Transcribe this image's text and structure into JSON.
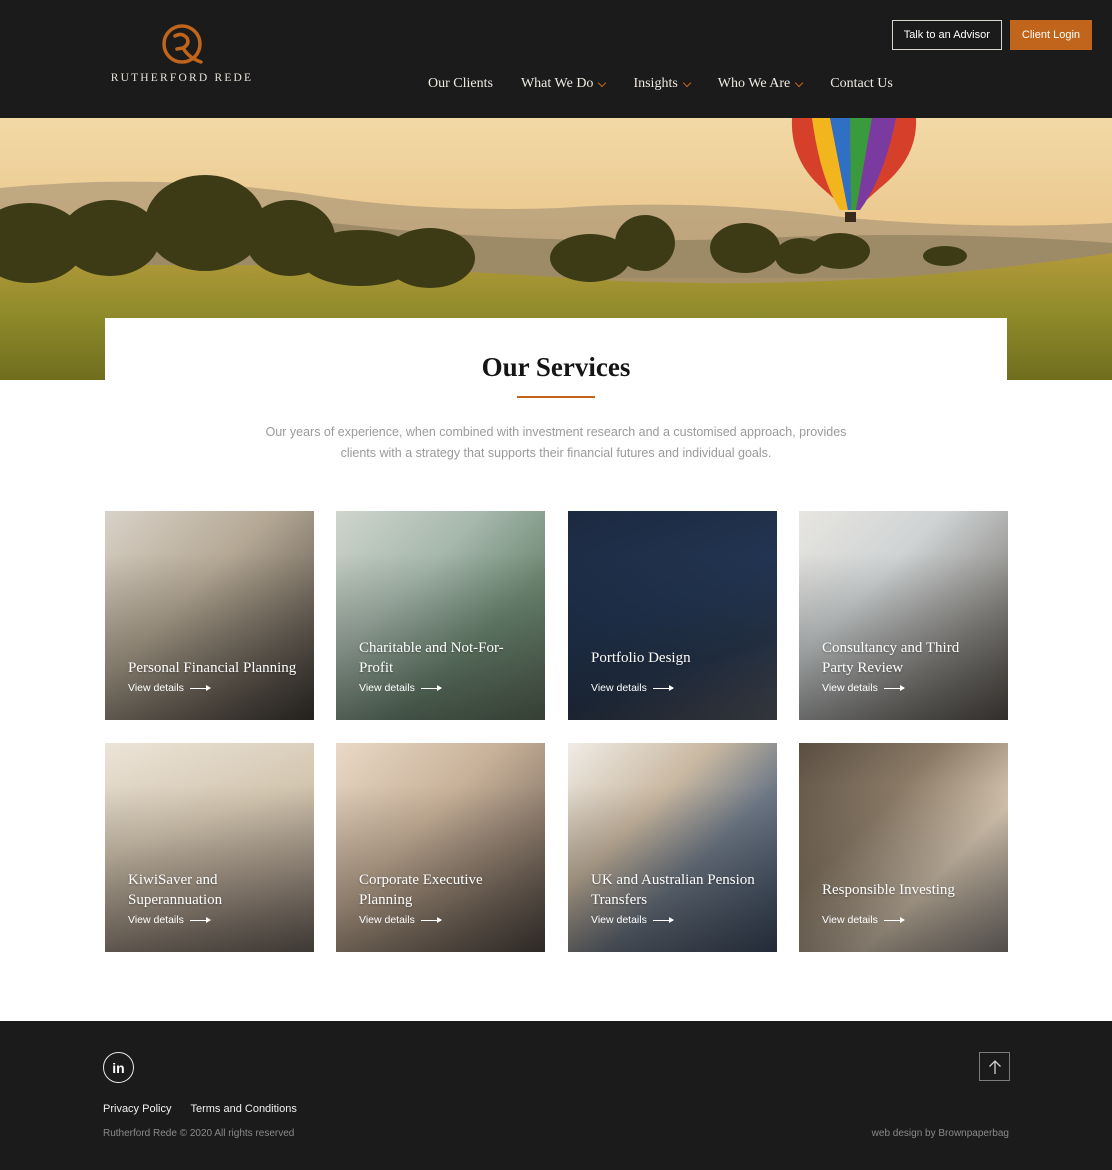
{
  "header": {
    "brand": "RUTHERFORD REDE",
    "buttons": {
      "advisor": "Talk to an Advisor",
      "login": "Client Login"
    },
    "nav": [
      {
        "label": "Our Clients",
        "dropdown": false
      },
      {
        "label": "What We Do",
        "dropdown": true
      },
      {
        "label": "Insights",
        "dropdown": true
      },
      {
        "label": "Who We Are",
        "dropdown": true
      },
      {
        "label": "Contact Us",
        "dropdown": false
      }
    ]
  },
  "services": {
    "title": "Our Services",
    "intro": "Our years of experience, when combined with investment research and a customised approach, provides clients with a strategy that supports their financial futures and individual goals.",
    "view_label": "View details",
    "cards": [
      {
        "title": "Personal Financial Planning"
      },
      {
        "title": "Charitable and Not-For-Profit"
      },
      {
        "title": "Portfolio Design"
      },
      {
        "title": "Consultancy and Third Party Review"
      },
      {
        "title": "KiwiSaver and Superannuation"
      },
      {
        "title": "Corporate Executive Planning"
      },
      {
        "title": "UK and Australian Pension Transfers"
      },
      {
        "title": "Responsible Investing"
      }
    ]
  },
  "footer": {
    "links": [
      "Privacy Policy",
      "Terms and Conditions"
    ],
    "copyright": "Rutherford Rede © 2020 All rights reserved",
    "credit": "web design by Brownpaperbag",
    "linkedin_icon": "linkedin-icon",
    "top_icon": "arrow-up-icon"
  },
  "colors": {
    "accent": "#c0651b",
    "dark": "#1b1b1b"
  }
}
